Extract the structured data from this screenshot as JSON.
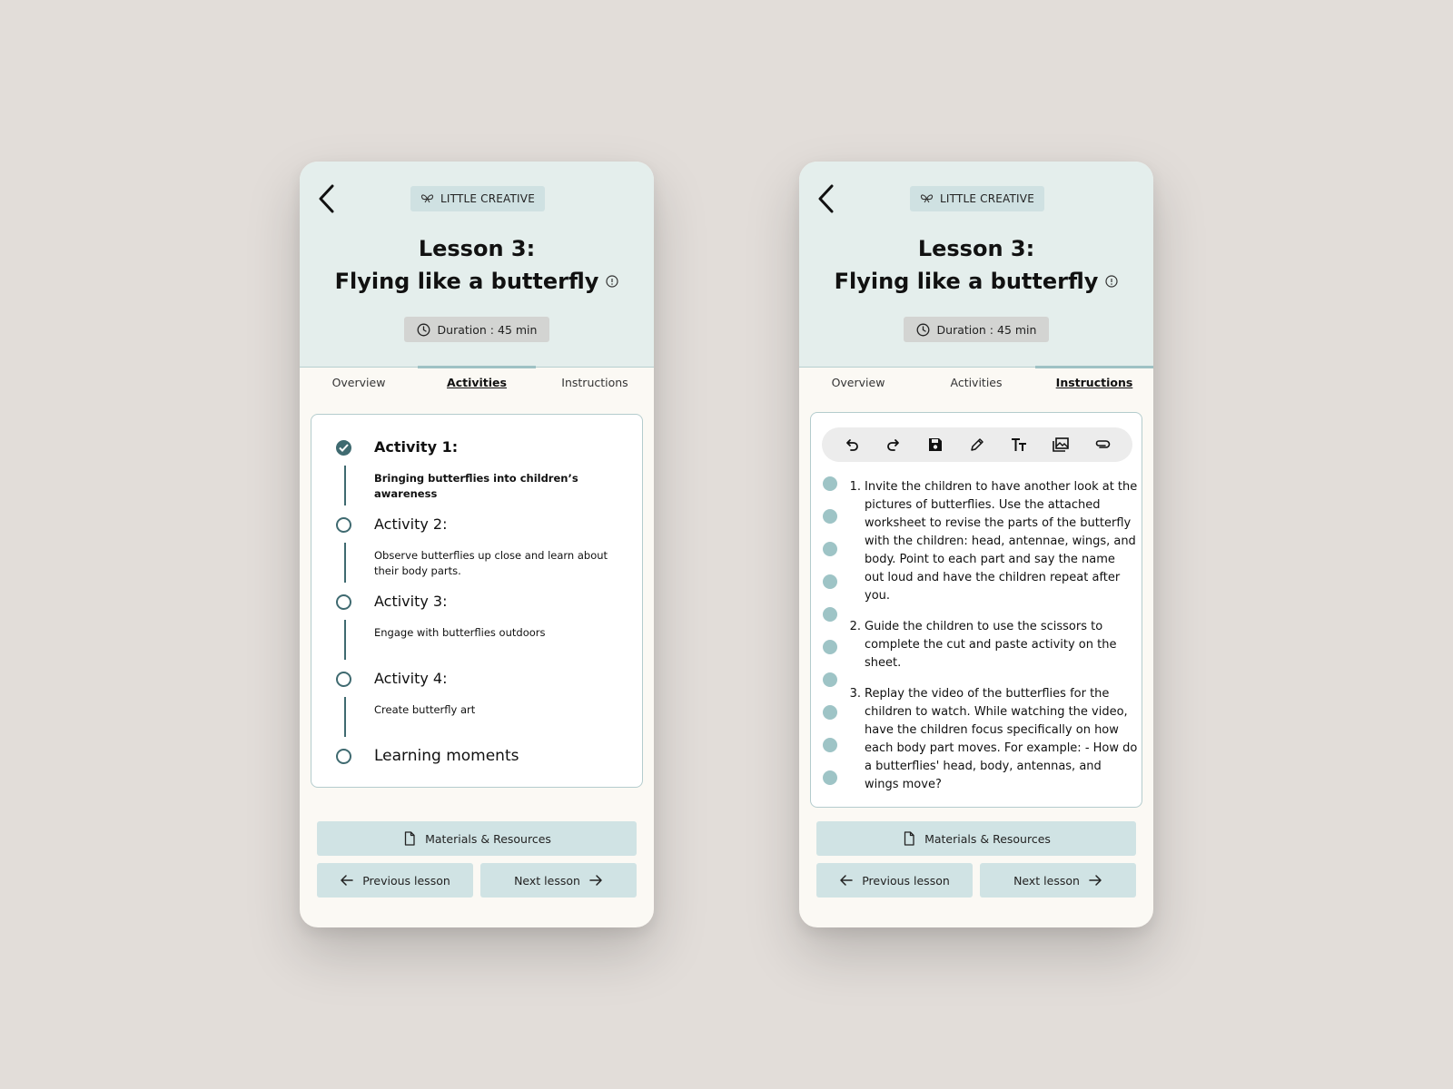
{
  "brand": {
    "label": "LITTLE CREATIVE"
  },
  "lesson": {
    "title_line1": "Lesson 3:",
    "title_line2": "Flying like a butterfly",
    "duration": "Duration : 45 min"
  },
  "tabs": {
    "overview": "Overview",
    "activities": "Activities",
    "instructions": "Instructions"
  },
  "screens": [
    {
      "active_tab": "Activities"
    },
    {
      "active_tab": "Instructions"
    }
  ],
  "activities": [
    {
      "title": "Activity 1:",
      "description": "Bringing butterflies into children’s awareness",
      "completed": true
    },
    {
      "title": "Activity 2:",
      "description": "Observe butterflies up close and learn about their body parts.",
      "completed": false
    },
    {
      "title": "Activity 3:",
      "description": "Engage with butterflies outdoors",
      "completed": false
    },
    {
      "title": "Activity 4:",
      "description": "Create butterfly art",
      "completed": false
    },
    {
      "title": "Learning moments",
      "description": "",
      "completed": false
    }
  ],
  "toolbar": [
    "undo-icon",
    "redo-icon",
    "save-icon",
    "pencil-icon",
    "text-size-icon",
    "image-icon",
    "attach-icon"
  ],
  "instructions": [
    {
      "num": "1.",
      "text": "Invite the children to have another look at the pictures of butterflies. Use the attached worksheet to revise the parts of the butterfly with the children: head, antennae, wings, and body. Point to each part and say the name out loud and have the children repeat after you."
    },
    {
      "num": "2.",
      "text": "Guide the children to use the scissors to complete the cut and paste activity on the sheet."
    },
    {
      "num": "3.",
      "text": "Replay the video of the butterflies for the children to watch. While watching the video, have the children focus specifically on how each body part moves. For example: - How do a butterflies' head, body, antennas, and wings move?"
    }
  ],
  "buttons": {
    "materials": "Materials & Resources",
    "previous": "Previous lesson",
    "next": "Next lesson"
  },
  "colors": {
    "header_bg": "#e4eeec",
    "accent": "#9ec4c6",
    "dark_teal": "#3f6a70",
    "button_bg": "#d0e3e4",
    "page_bg": "#e2ddd9"
  }
}
